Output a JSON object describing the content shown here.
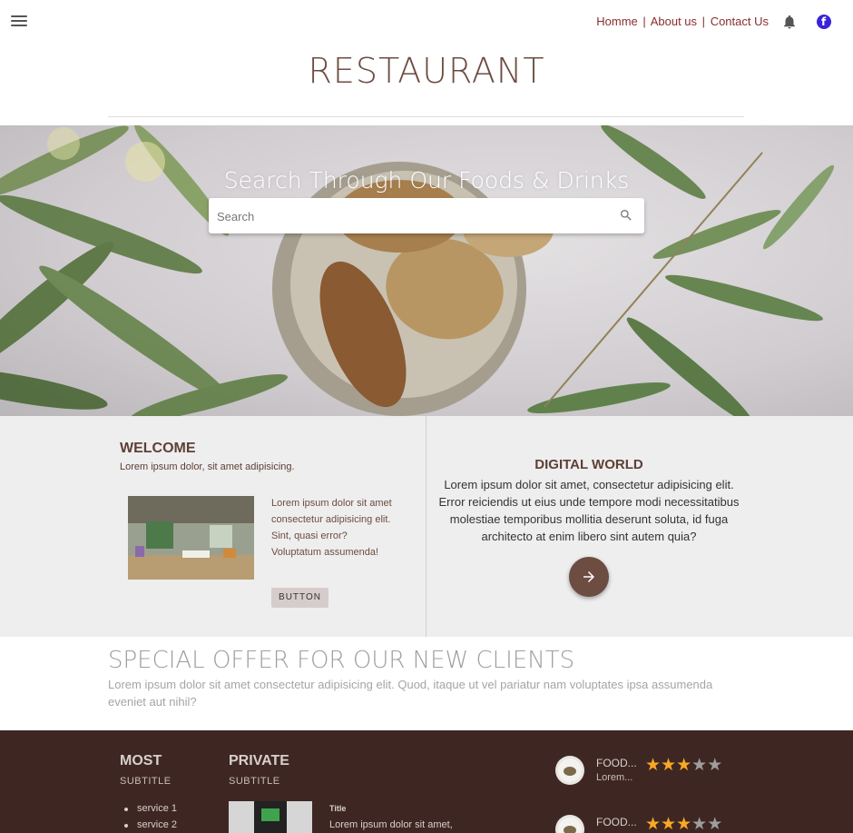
{
  "nav": {
    "links": [
      "Homme",
      "About us",
      "Contact Us"
    ],
    "separator": "|"
  },
  "logo": "RESTAURANT",
  "hero": {
    "title": "Search Through Our Foods & Drinks",
    "search_placeholder": "Search"
  },
  "welcome": {
    "title": "WELCOME",
    "subtitle": "Lorem ipsum dolor, sit amet adipisicing.",
    "body": "Lorem ipsum dolor sit amet consectetur adipisicing elit. Sint, quasi error? Voluptatum assumenda!",
    "button": "BUTTON"
  },
  "digital": {
    "title": "DIGITAL WORLD",
    "body": "Lorem ipsum dolor sit amet, consectetur adipisicing elit. Error reiciendis ut eius unde tempore modi necessitatibus molestiae temporibus mollitia deserunt soluta, id fuga architecto at enim libero sint autem quia?"
  },
  "offer": {
    "title": "SPECIAL OFFER FOR OUR NEW CLIENTS",
    "body": "Lorem ipsum dolor sit amet consectetur adipisicing elit. Quod, itaque ut vel pariatur nam voluptates ipsa assumenda eveniet aut nihil?"
  },
  "footer": {
    "most": {
      "title": "MOST",
      "subtitle": "SUBTITLE",
      "services": [
        "service 1",
        "service 2"
      ]
    },
    "private": {
      "title": "PRIVATE",
      "subtitle": "SUBTITLE",
      "item_title": "Title",
      "item_text": "Lorem ipsum dolor sit amet,"
    },
    "foods": [
      {
        "name": "FOOD...",
        "desc": "Lorem...",
        "rating": 3,
        "max": 5
      },
      {
        "name": "FOOD...",
        "desc": "",
        "rating": 3,
        "max": 5
      }
    ]
  },
  "colors": {
    "brand": "#6d4c41",
    "footer_bg": "#3e2723",
    "nav_link": "#8a2d2d",
    "star": "#f9a825",
    "facebook": "#3b23d8"
  },
  "icons": [
    "menu-icon",
    "bell-icon",
    "facebook-icon",
    "search-icon",
    "arrow-right-icon"
  ]
}
